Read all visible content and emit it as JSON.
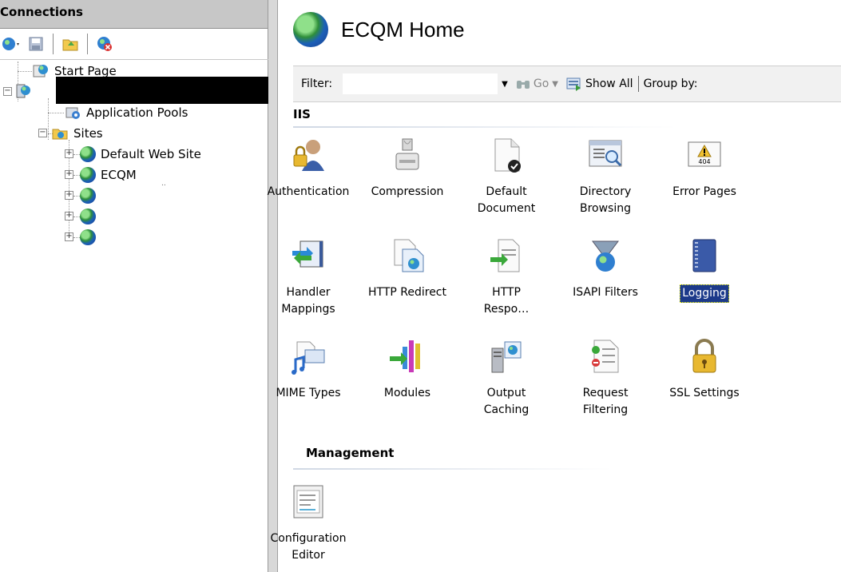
{
  "connections": {
    "title": "Connections",
    "toolbar": [
      "connect-icon",
      "save-icon",
      "folder-icon",
      "disconnect-icon"
    ],
    "tree": {
      "start_page": "Start Page",
      "server_name": "",
      "app_pools": "Application Pools",
      "sites": "Sites",
      "site_items": [
        "Default Web Site",
        "ECQM",
        "",
        "",
        ""
      ],
      "ecqm_sub": ".."
    }
  },
  "home": {
    "title": "ECQM Home"
  },
  "filterbar": {
    "filter_label": "Filter:",
    "filter_value": "",
    "go_label": "Go",
    "show_all_label": "Show All",
    "group_by_label": "Group by:"
  },
  "groups": {
    "iis": {
      "title": "IIS",
      "features": [
        {
          "label": "Authentication",
          "icon": "authentication-icon"
        },
        {
          "label": "Compression",
          "icon": "compression-icon"
        },
        {
          "label": "Default\nDocument",
          "icon": "default-document-icon"
        },
        {
          "label": "Directory\nBrowsing",
          "icon": "directory-browsing-icon"
        },
        {
          "label": "Error Pages",
          "icon": "error-pages-icon"
        },
        {
          "label": "Handler\nMappings",
          "icon": "handler-mappings-icon"
        },
        {
          "label": "HTTP Redirect",
          "icon": "http-redirect-icon"
        },
        {
          "label": "HTTP\nRespo…",
          "icon": "http-response-icon"
        },
        {
          "label": "ISAPI Filters",
          "icon": "isapi-filters-icon"
        },
        {
          "label": "Logging",
          "icon": "logging-icon",
          "selected": true
        },
        {
          "label": "MIME Types",
          "icon": "mime-types-icon"
        },
        {
          "label": "Modules",
          "icon": "modules-icon"
        },
        {
          "label": "Output\nCaching",
          "icon": "output-caching-icon"
        },
        {
          "label": "Request\nFiltering",
          "icon": "request-filtering-icon"
        },
        {
          "label": "SSL Settings",
          "icon": "ssl-settings-icon"
        }
      ]
    },
    "management": {
      "title": "Management",
      "features": [
        {
          "label": "Configuration\nEditor",
          "icon": "configuration-editor-icon"
        }
      ]
    }
  },
  "colors": {
    "selection_bg": "#1c3a8a",
    "title_bar": "#c7c7c7",
    "filter_bar": "#f1f1f1"
  }
}
